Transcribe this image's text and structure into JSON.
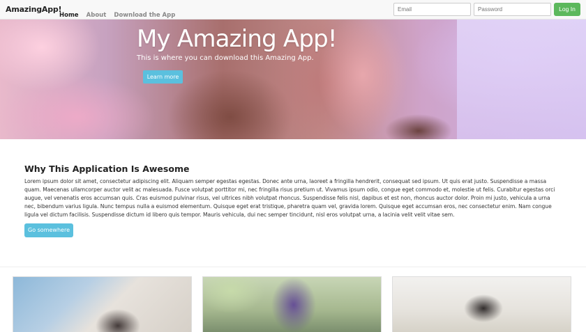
{
  "navbar": {
    "brand": "AmazingApp!",
    "links": [
      {
        "label": "Home",
        "active": true
      },
      {
        "label": "About",
        "active": false
      },
      {
        "label": "Download the App",
        "active": false
      }
    ],
    "email_placeholder": "Email",
    "password_placeholder": "Password",
    "login_label": "Log In"
  },
  "hero": {
    "title": "My Amazing App!",
    "subtitle": "This is where you can download this Amazing App.",
    "button_label": "Learn more"
  },
  "about": {
    "title": "Why This Application Is Awesome",
    "body": "Lorem ipsum dolor sit amet, consectetur adipiscing elit. Aliquam semper egestas egestas. Donec ante urna, laoreet a fringilla hendrerit, consequat sed ipsum. Ut quis erat justo. Suspendisse a massa quam. Maecenas ullamcorper auctor velit ac malesuada. Fusce volutpat porttitor mi, nec fringilla risus pretium ut. Vivamus ipsum odio, congue eget commodo et, molestie ut felis. Curabitur egestas orci augue, vel venenatis eros accumsan quis. Cras euismod pulvinar risus, vel ultrices nibh volutpat rhoncus. Suspendisse felis nisl, dapibus et est non, rhoncus auctor dolor. Proin mi justo, vehicula a urna nec, bibendum varius ligula. Nunc tempus nulla a euismod elementum. Quisque eget erat tristique, pharetra quam vel, gravida lorem. Quisque eget accumsan eros, nec consectetur enim. Nam congue ligula vel dictum facilisis. Suspendisse dictum id libero quis tempor. Mauris vehicula, dui nec semper tincidunt, nisl eros volutpat urna, a lacinia velit velit vitae sem.",
    "button_label": "Go somewhere"
  },
  "colors": {
    "success": "#5cb85c",
    "info": "#5bc0de",
    "navbar_bg": "#f8f8f8"
  }
}
